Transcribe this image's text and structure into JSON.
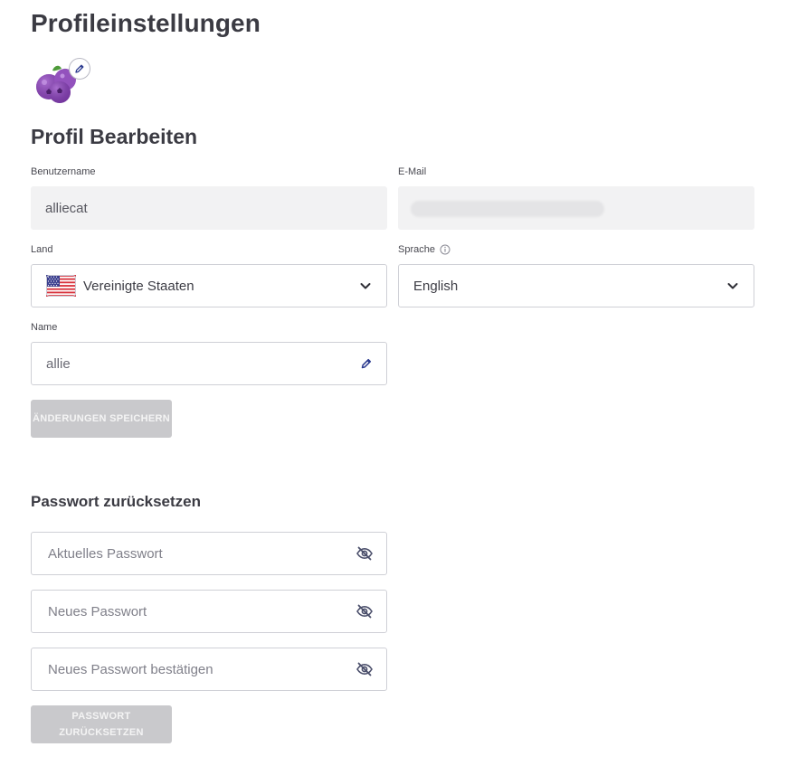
{
  "page": {
    "title": "Profileinstellungen"
  },
  "profile": {
    "section_title": "Profil Bearbeiten",
    "username": {
      "label": "Benutzername",
      "value": "alliecat"
    },
    "email": {
      "label": "E-Mail",
      "value": ""
    },
    "country": {
      "label": "Land",
      "value": "Vereinigte Staaten",
      "flag": "us-flag-icon"
    },
    "language": {
      "label": "Sprache",
      "value": "English",
      "info_icon": "info-icon"
    },
    "name": {
      "label": "Name",
      "value": "allie"
    },
    "save_button": "ÄNDERUNGEN SPEICHERN"
  },
  "password": {
    "section_title": "Passwort zurücksetzen",
    "current_placeholder": "Aktuelles Passwort",
    "new_placeholder": "Neues Passwort",
    "confirm_placeholder": "Neues Passwort bestätigen",
    "reset_button_line1": "PASSWORT",
    "reset_button_line2": "ZURÜCKSETZEN"
  },
  "colors": {
    "accent": "#2b3a8f",
    "disabled_button": "#c9c9cc",
    "readonly_bg": "#f2f2f3",
    "border": "#cfd0d6"
  }
}
